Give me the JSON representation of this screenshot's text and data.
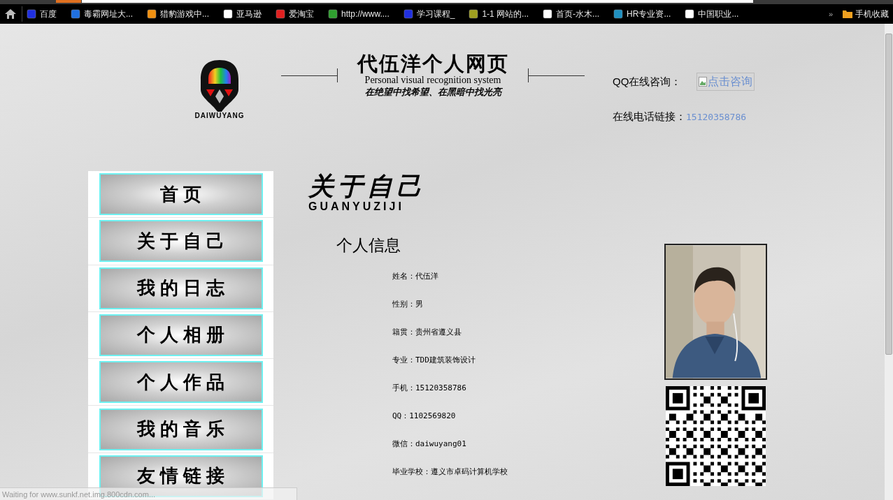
{
  "bookmarks": [
    {
      "label": "百度"
    },
    {
      "label": "毒霸网址大..."
    },
    {
      "label": "猎豹游戏中..."
    },
    {
      "label": "亚马逊"
    },
    {
      "label": "爱淘宝"
    },
    {
      "label": "http://www...."
    },
    {
      "label": "学习课程_"
    },
    {
      "label": "1-1 网站的..."
    },
    {
      "label": "首页-水木..."
    },
    {
      "label": "HR专业资..."
    },
    {
      "label": "中国职业..."
    }
  ],
  "bookmarks_more": "»",
  "bookmarks_folder": "手机收藏",
  "header": {
    "site_title": "代伍洋个人网页",
    "subtitle": "Personal visual recognition system",
    "slogan": "在绝望中找希望、在黑暗中找光亮",
    "logo_text": "DAIWUYANG",
    "qq_label": "QQ在线咨询：",
    "qq_image_alt": "点击咨询",
    "phone_label": "在线电话链接：",
    "phone": "15120358786"
  },
  "nav": [
    "首 页",
    "关 于 自 己",
    "我 的 日 志",
    "个 人 相 册",
    "个 人 作 品",
    "我 的 音 乐",
    "友 情 链 接"
  ],
  "section": {
    "title": "关于自己",
    "title_pinyin": "GUANYUZIJI",
    "subtitle": "个人信息"
  },
  "info": [
    "姓名：代伍洋",
    "性别：男",
    "籍贯：贵州省遵义县",
    "专业：TDD建筑装饰设计",
    "手机：15120358786",
    "QQ：1102569820",
    "微信：daiwuyang01",
    "毕业学校：遵义市卓码计算机学校"
  ],
  "status_bar": "Waiting for www.sunkf.net.img.800cdn.com..."
}
